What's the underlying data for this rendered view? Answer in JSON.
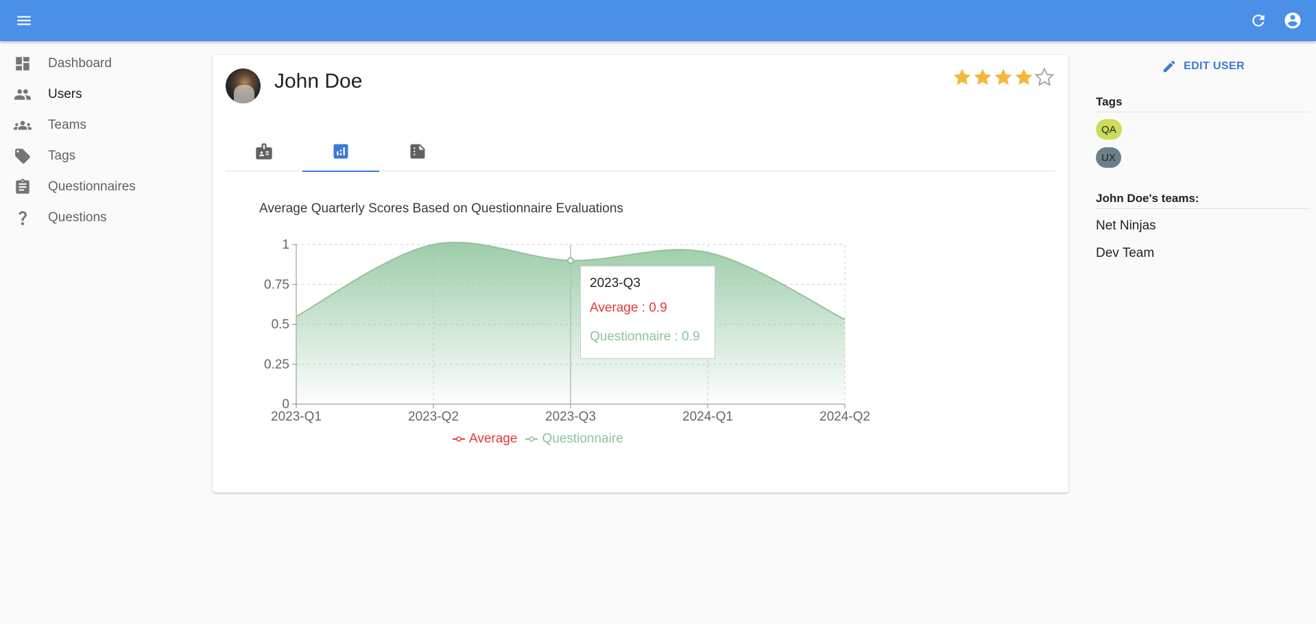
{
  "appbar": {
    "menu_icon": "menu-icon",
    "refresh_icon": "refresh-icon",
    "account_icon": "account-circle-icon",
    "color": "#4a90e9"
  },
  "sidebar": {
    "items": [
      {
        "label": "Dashboard",
        "icon": "dashboard-icon"
      },
      {
        "label": "Users",
        "icon": "users-icon"
      },
      {
        "label": "Teams",
        "icon": "teams-icon"
      },
      {
        "label": "Tags",
        "icon": "tag-icon"
      },
      {
        "label": "Questionnaires",
        "icon": "clipboard-icon"
      },
      {
        "label": "Questions",
        "icon": "question-mark-icon"
      }
    ],
    "active": "Users"
  },
  "user": {
    "name": "John Doe",
    "rating": 4,
    "rating_max": 5,
    "star_color": "#f4b73c"
  },
  "tabs": [
    {
      "icon": "id-badge-icon",
      "active": false
    },
    {
      "icon": "bar-chart-icon",
      "active": true
    },
    {
      "icon": "document-icon",
      "active": false
    }
  ],
  "chart_data": {
    "type": "area",
    "title": "Average Quarterly Scores Based on Questionnaire Evaluations",
    "categories": [
      "2023-Q1",
      "2023-Q2",
      "2023-Q3",
      "2024-Q1",
      "2024-Q2"
    ],
    "series": [
      {
        "name": "Average",
        "values": [
          0.55,
          1,
          0.9,
          0.95,
          0.53
        ],
        "color": "#e53935"
      },
      {
        "name": "Questionnaire",
        "values": [
          0.55,
          1,
          0.9,
          0.95,
          0.53
        ],
        "color": "#8bc49a"
      }
    ],
    "ylim": [
      0,
      1
    ],
    "yticks": [
      "0",
      "0.25",
      "0.5",
      "0.75",
      "1"
    ],
    "grid": true,
    "legend": "bottom",
    "tooltip": {
      "title": "2023-Q3",
      "average": "Average : 0.9",
      "questionnaire": "Questionnaire : 0.9"
    }
  },
  "right_panel": {
    "edit_label": "EDIT USER",
    "tags_title": "Tags",
    "tags": [
      {
        "label": "QA",
        "color": "#cddc5b"
      },
      {
        "label": "UX",
        "color": "#6b7f8c"
      }
    ],
    "teams_title": "John Doe's teams:",
    "teams": [
      "Net Ninjas",
      "Dev Team"
    ]
  }
}
